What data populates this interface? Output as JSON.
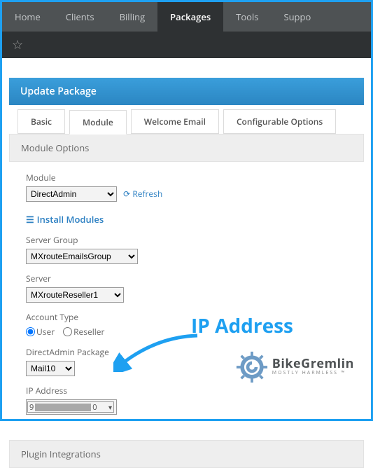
{
  "nav": {
    "items": [
      "Home",
      "Clients",
      "Billing",
      "Packages",
      "Tools",
      "Suppo"
    ],
    "active_index": 3
  },
  "panel": {
    "title": "Update Package"
  },
  "tabs": {
    "items": [
      "Basic",
      "Module",
      "Welcome Email",
      "Configurable Options"
    ],
    "active_index": 1
  },
  "section1": "Module Options",
  "section2": "Plugin Integrations",
  "module": {
    "label": "Module",
    "value": "DirectAdmin",
    "refresh": "Refresh",
    "install": "Install Modules"
  },
  "server_group": {
    "label": "Server Group",
    "value": "MXrouteEmailsGroup"
  },
  "server": {
    "label": "Server",
    "value": "MXrouteReseller1"
  },
  "account_type": {
    "label": "Account Type",
    "opt_user": "User",
    "opt_reseller": "Reseller"
  },
  "da_package": {
    "label": "DirectAdmin Package",
    "value": "Mail10"
  },
  "ip": {
    "label": "IP Address",
    "prefix": "9",
    "suffix": "0"
  },
  "annotation": {
    "label": "IP Address"
  },
  "logo": {
    "name": "BikeGremlin",
    "tagline": "MOSTLY HARMLESS ™"
  }
}
